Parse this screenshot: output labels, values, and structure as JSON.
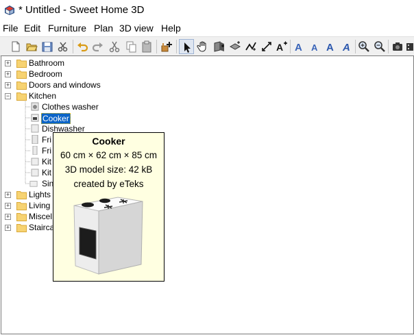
{
  "window": {
    "title": "* Untitled - Sweet Home 3D"
  },
  "menu": [
    "File",
    "Edit",
    "Furniture",
    "Plan",
    "3D view",
    "Help"
  ],
  "toolbar": {
    "buttons": [
      "new-file-icon",
      "open-folder-icon",
      "save-icon",
      "cut-preferences-icon",
      "undo-icon",
      "redo-icon",
      "cut-icon",
      "copy-icon",
      "paste-icon",
      "add-furniture-icon",
      "select-arrow-icon",
      "pan-hand-icon",
      "create-walls-icon",
      "create-rooms-icon",
      "create-polylines-icon",
      "create-dimensions-icon",
      "add-text-icon",
      "increase-text-icon",
      "decrease-text-icon",
      "bold-text-icon",
      "italic-text-icon",
      "zoom-in-icon",
      "zoom-out-icon",
      "create-photo-icon",
      "create-video-icon"
    ]
  },
  "tree": {
    "categories": [
      "Bathroom",
      "Bedroom",
      "Doors and windows",
      "Kitchen"
    ],
    "kitchen_items": [
      "Clothes washer",
      "Cooker",
      "Dishwasher",
      "Fri",
      "Fri",
      "Kit",
      "Kit",
      "Sin"
    ],
    "selected_item": "Cooker",
    "categories_after": [
      "Lights",
      "Living",
      "Miscel",
      "Stairca"
    ]
  },
  "tooltip": {
    "name": "Cooker",
    "dimensions": "60 cm × 62 cm × 85 cm",
    "model_size": "3D model size: 42 kB",
    "creator": "created by eTeks"
  },
  "colors": {
    "selection": "#0a64c8",
    "tooltip_bg": "#ffffe1",
    "folder": "#f7d372"
  }
}
